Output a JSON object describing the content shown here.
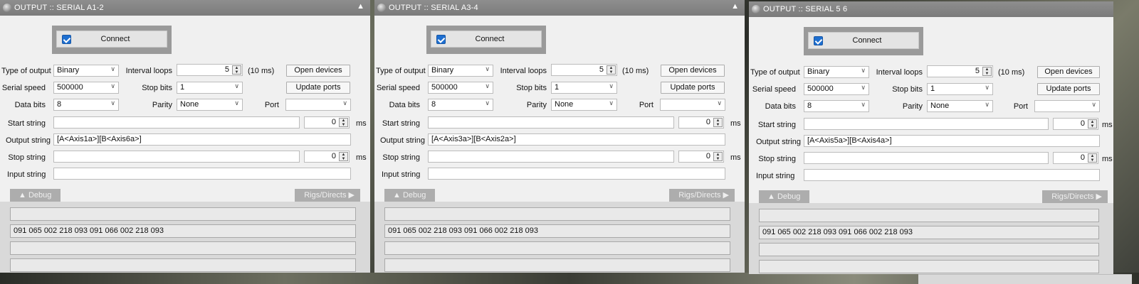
{
  "panels": [
    {
      "title": "OUTPUT :: SERIAL A1-2",
      "collapse_glyph": "▲",
      "connect_label": "Connect",
      "type_of_output_label": "Type of output",
      "type_of_output_value": "Binary",
      "serial_speed_label": "Serial speed",
      "serial_speed_value": "500000",
      "data_bits_label": "Data bits",
      "data_bits_value": "8",
      "interval_loops_label": "Interval loops",
      "interval_loops_value": "5",
      "interval_ms": "(10 ms)",
      "stop_bits_label": "Stop bits",
      "stop_bits_value": "1",
      "parity_label": "Parity",
      "parity_value": "None",
      "port_label": "Port",
      "port_value": "",
      "open_devices_label": "Open devices",
      "update_ports_label": "Update ports",
      "start_string_label": "Start string",
      "start_string_value": "",
      "start_delay_value": "0",
      "start_unit": "ms",
      "output_string_label": "Output string",
      "output_string_value": "[A<Axis1a>][B<Axis6a>]",
      "stop_string_label": "Stop string",
      "stop_string_value": "",
      "stop_delay_value": "0",
      "stop_unit": "ms",
      "input_string_label": "Input string",
      "input_string_value": "",
      "debug_tab_label": "▲  Debug",
      "rigs_tab_label": "Rigs/Directs  ▶",
      "debug_lines": [
        "",
        "091 065 002 218 093 091 066 002 218 093",
        "",
        ""
      ]
    },
    {
      "title": "OUTPUT :: SERIAL A3-4",
      "collapse_glyph": "▲",
      "connect_label": "Connect",
      "type_of_output_label": "Type of output",
      "type_of_output_value": "Binary",
      "serial_speed_label": "Serial speed",
      "serial_speed_value": "500000",
      "data_bits_label": "Data bits",
      "data_bits_value": "8",
      "interval_loops_label": "Interval loops",
      "interval_loops_value": "5",
      "interval_ms": "(10 ms)",
      "stop_bits_label": "Stop bits",
      "stop_bits_value": "1",
      "parity_label": "Parity",
      "parity_value": "None",
      "port_label": "Port",
      "port_value": "",
      "open_devices_label": "Open devices",
      "update_ports_label": "Update ports",
      "start_string_label": "Start string",
      "start_string_value": "",
      "start_delay_value": "0",
      "start_unit": "ms",
      "output_string_label": "Output string",
      "output_string_value": "[A<Axis3a>][B<Axis2a>]",
      "stop_string_label": "Stop string",
      "stop_string_value": "",
      "stop_delay_value": "0",
      "stop_unit": "ms",
      "input_string_label": "Input string",
      "input_string_value": "",
      "debug_tab_label": "▲  Debug",
      "rigs_tab_label": "Rigs/Directs  ▶",
      "debug_lines": [
        "",
        "091 065 002 218 093 091 066 002 218 093",
        "",
        ""
      ]
    },
    {
      "title": "OUTPUT :: SERIAL 5 6",
      "collapse_glyph": "",
      "connect_label": "Connect",
      "type_of_output_label": "Type of output",
      "type_of_output_value": "Binary",
      "serial_speed_label": "Serial speed",
      "serial_speed_value": "500000",
      "data_bits_label": "Data bits",
      "data_bits_value": "8",
      "interval_loops_label": "Interval loops",
      "interval_loops_value": "5",
      "interval_ms": "(10 ms)",
      "stop_bits_label": "Stop bits",
      "stop_bits_value": "1",
      "parity_label": "Parity",
      "parity_value": "None",
      "port_label": "Port",
      "port_value": "",
      "open_devices_label": "Open devices",
      "update_ports_label": "Update ports",
      "start_string_label": "Start string",
      "start_string_value": "",
      "start_delay_value": "0",
      "start_unit": "ms",
      "output_string_label": "Output string",
      "output_string_value": "[A<Axis5a>][B<Axis4a>]",
      "stop_string_label": "Stop string",
      "stop_string_value": "",
      "stop_delay_value": "0",
      "stop_unit": "ms",
      "input_string_label": "Input string",
      "input_string_value": "",
      "debug_tab_label": "▲  Debug",
      "rigs_tab_label": "Rigs/Directs  ▶",
      "debug_lines": [
        "",
        "091 065 002 218 093 091 066 002 218 093",
        "",
        ""
      ]
    }
  ]
}
